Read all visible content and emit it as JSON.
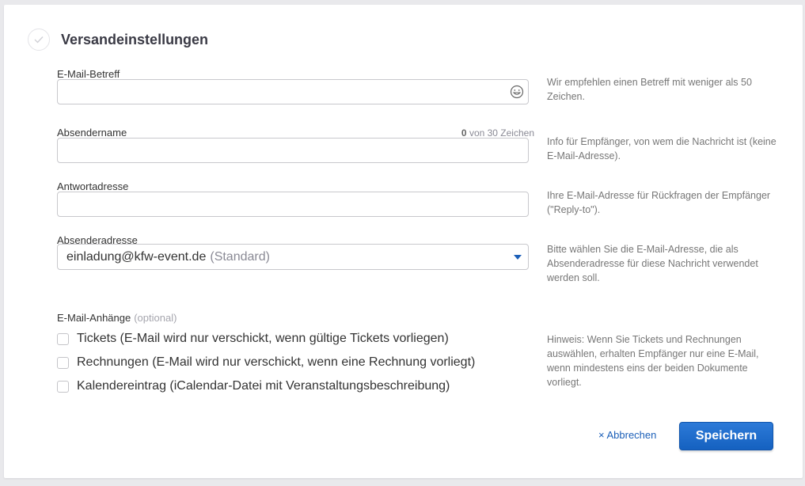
{
  "section": {
    "title": "Versandeinstellungen",
    "icon": "check-icon"
  },
  "fields": {
    "subject": {
      "label": "E-Mail-Betreff",
      "value": "",
      "help": "Wir empfehlen einen Betreff mit weniger als 50 Zeichen."
    },
    "sender_name": {
      "label": "Absendername",
      "value": "",
      "counter_count": "0",
      "counter_suffix": " von 30 Zeichen",
      "help": "Info für Empfänger, von wem die Nachricht ist (keine E-Mail-Adresse)."
    },
    "reply_to": {
      "label": "Antwortadresse",
      "value": "",
      "help": "Ihre E-Mail-Adresse für Rückfragen der Empfänger (\"Reply-to\")."
    },
    "sender_address": {
      "label": "Absenderadresse",
      "value": "einladung@kfw-event.de",
      "value_suffix": "(Standard)",
      "help": "Bitte wählen Sie die E-Mail-Adresse, die als Absenderadresse für diese Nachricht verwendet werden soll."
    }
  },
  "attachments": {
    "label": "E-Mail-Anhänge",
    "optional": "(optional)",
    "options": [
      {
        "label": "Tickets (E-Mail wird nur verschickt, wenn gültige Tickets vorliegen)",
        "checked": false
      },
      {
        "label": "Rechnungen (E-Mail wird nur verschickt, wenn eine Rechnung vorliegt)",
        "checked": false
      },
      {
        "label": "Kalendereintrag (iCalendar-Datei mit Veranstaltungsbeschreibung)",
        "checked": false
      }
    ],
    "help": "Hinweis: Wenn Sie Tickets und Rechnungen auswählen, erhalten Empfänger nur eine E-Mail, wenn mindestens eins der beiden Dokumente vorliegt."
  },
  "actions": {
    "cancel_label": "× Abbrechen",
    "save_label": "Speichern"
  },
  "colors": {
    "accent": "#1b5fb8",
    "button": "#1e6ccb"
  }
}
